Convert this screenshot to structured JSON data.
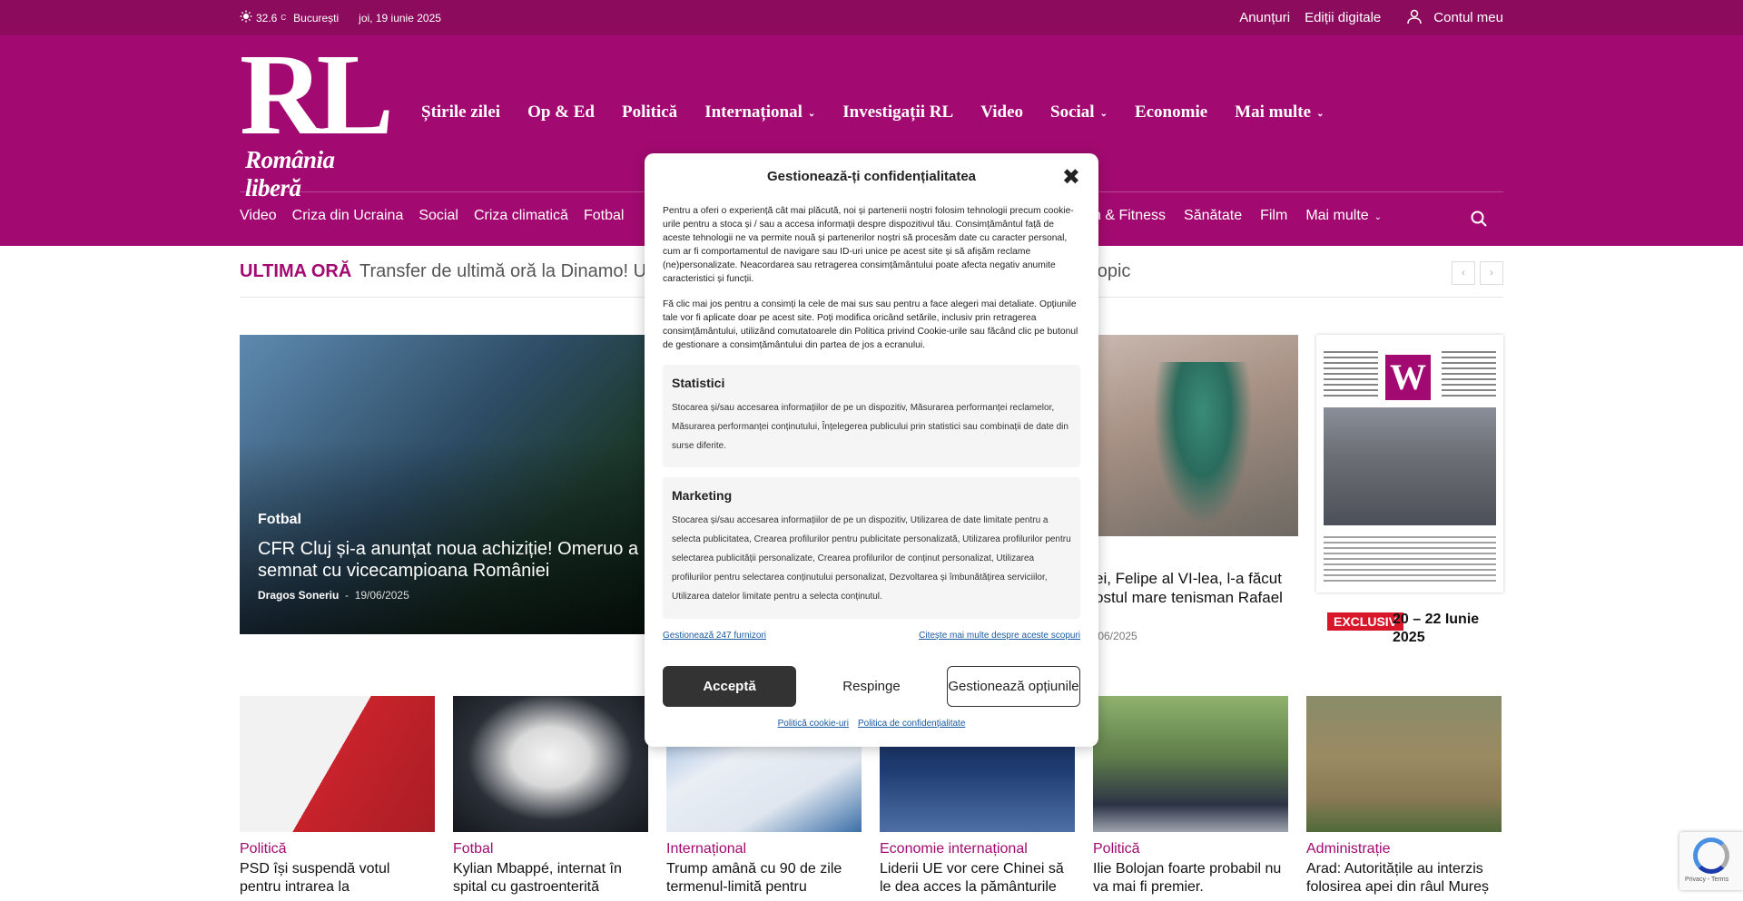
{
  "topbar": {
    "temperature": "32.6",
    "unit": "C",
    "city": "București",
    "date": "joi, 19 iunie 2025",
    "links": [
      "Anunțuri",
      "Ediții digitale"
    ],
    "account": "Contul meu"
  },
  "logo": {
    "main": "RL",
    "sub": "România liberă"
  },
  "main_nav": [
    "Știrile zilei",
    "Op & Ed",
    "Politică",
    "Internațional",
    "Investigații RL",
    "Video",
    "Social",
    "Economie",
    "Mai multe"
  ],
  "sub_nav_left": [
    "Video",
    "Criza din Ucraina",
    "Social",
    "Criza climatică",
    "Fotbal"
  ],
  "sub_nav_right": [
    "h & Fitness",
    "Sănătate",
    "Film",
    "Mai multe"
  ],
  "ticker": {
    "label": "ULTIMA ORĂ",
    "text": "Transfer de ultimă oră la Dinamo! Ur",
    "text_tail": "opic"
  },
  "hero": {
    "category": "Fotbal",
    "title": "CFR Cluj și-a anunțat noua achiziție! Omeruo a semnat cu vicecampioana României",
    "author": "Dragos Soneriu",
    "date": "19/06/2025"
  },
  "tennis": {
    "title": "ei, Felipe al VI-lea, l-a făcut ostul mare tenisman Rafael",
    "date": "/06/2025"
  },
  "digital": {
    "badge": "EXCLUSIV",
    "title": "20 – 22 Iunie 2025"
  },
  "cards": [
    {
      "category": "Politică",
      "title": "PSD își suspendă votul pentru intrarea la",
      "color": "#c8232c"
    },
    {
      "category": "Fotbal",
      "title": "Kylian Mbappé, internat în spital cu gastroenterită",
      "color": "#2a2f38"
    },
    {
      "category": "Internațional",
      "title": "Trump amână cu 90 de zile termenul-limită pentru",
      "color": "#3b6fa8"
    },
    {
      "category": "Economie internațional",
      "title": "Liderii UE vor cere Chinei să le dea acces la pământurile",
      "color": "#1f3d73"
    },
    {
      "category": "Politică",
      "title": "Ilie Bolojan foarte probabil nu va mai fi premier.",
      "color": "#5e7d4a"
    },
    {
      "category": "Administrație",
      "title": "Arad: Autoritățile au interzis folosirea apei din râul Mureș",
      "color": "#8a7a55"
    }
  ],
  "modal": {
    "title": "Gestionează-ți confidențialitatea",
    "intro1": "Pentru a oferi o experiență cât mai plăcută, noi și partenerii noștri folosim tehnologii precum cookie-urile pentru a stoca și / sau a accesa informații despre dispozitivul tău. Consimțământul față de aceste tehnologii ne va permite nouă și partenerilor noștri să procesăm date cu caracter personal, cum ar fi comportamentul de navigare sau ID-uri unice pe acest site și să afișăm reclame (ne)personalizate. Neacordarea sau retragerea consimțământului poate afecta negativ anumite caracteristici și funcții.",
    "intro2": "Fă clic mai jos pentru a consimți la cele de mai sus sau pentru a face alegeri mai detaliate. Opțiunile tale vor fi aplicate doar pe acest site. Poți modifica oricând setările, inclusiv prin retragerea consimțământului, utilizând comutatoarele din Politica privind Cookie-urile sau făcând clic pe butonul de gestionare a consimțământului din partea de jos a ecranului.",
    "stats_title": "Statistici",
    "stats_desc": "Stocarea și/sau accesarea informațiilor de pe un dispozitiv, Măsurarea performanței reclamelor, Măsurarea performanței conținutului, Înțelegerea publicului prin statistici sau combinații de date din surse diferite.",
    "marketing_title": "Marketing",
    "marketing_desc": "Stocarea și/sau accesarea informațiilor de pe un dispozitiv, Utilizarea de date limitate pentru a selecta publicitatea, Crearea profilurilor pentru publicitate personalizată, Utilizarea profilurilor pentru selectarea publicității personalizate, Crearea profilurilor de conținut personalizat, Utilizarea profilurilor pentru selectarea conținutului personalizat, Dezvoltarea și îmbunătățirea serviciilor, Utilizarea datelor limitate pentru a selecta conținutul.",
    "vendors_link": "Gestionează 247 furnizori",
    "more_link": "Citește mai multe despre aceste scopuri",
    "accept": "Acceptă",
    "reject": "Respinge",
    "options": "Gestionează opțiunile",
    "cookie_policy": "Politică cookie-uri",
    "privacy_policy": "Politica de confidențialitate"
  },
  "recaptcha": {
    "links": "Privacy - Terms"
  },
  "colors": {
    "brand": "#a30a71",
    "topbar": "#8c0b5d",
    "badge": "#d8182a",
    "accept_button": "#333333"
  }
}
